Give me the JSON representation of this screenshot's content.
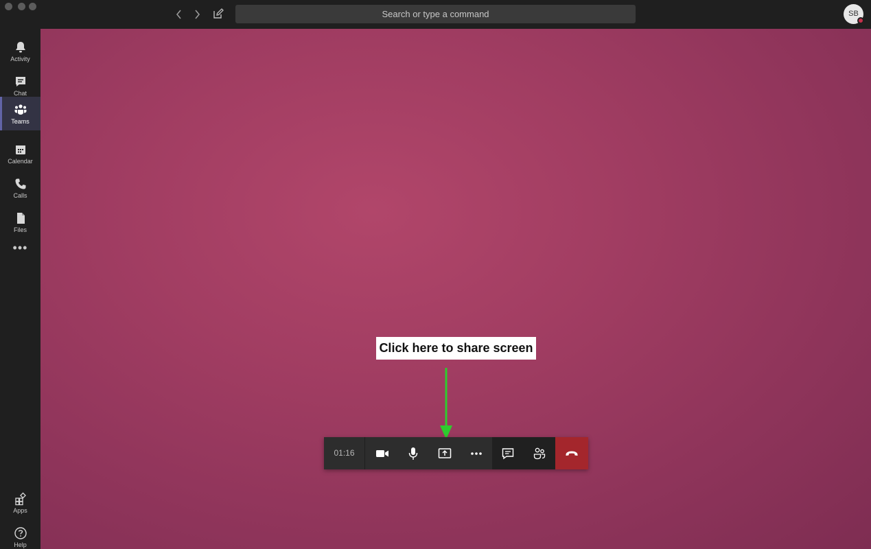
{
  "titlebar": {
    "search_placeholder": "Search or type a command",
    "avatar_initials": "SB",
    "back_icon": "chevron-left-icon",
    "forward_icon": "chevron-right-icon",
    "compose_icon": "new-chat-icon"
  },
  "rail": {
    "items": [
      {
        "label": "Activity",
        "icon": "bell-icon"
      },
      {
        "label": "Chat",
        "icon": "chat-icon"
      },
      {
        "label": "Teams",
        "icon": "teams-icon",
        "active": true
      },
      {
        "label": "Calendar",
        "icon": "calendar-icon"
      },
      {
        "label": "Calls",
        "icon": "phone-icon"
      },
      {
        "label": "Files",
        "icon": "file-icon"
      }
    ],
    "more_label": "•••",
    "bottom_items": [
      {
        "label": "Apps",
        "icon": "apps-icon"
      },
      {
        "label": "Help",
        "icon": "help-icon"
      }
    ]
  },
  "call": {
    "timer": "01:16",
    "controls": [
      "video-camera-icon",
      "microphone-icon",
      "share-screen-icon",
      "more-options-icon",
      "conversation-icon",
      "participants-icon",
      "hang-up-icon"
    ]
  },
  "annotation": {
    "callout_text": "Click here to share screen",
    "arrow_color": "#2ecc2e"
  },
  "colors": {
    "accent": "#6264a7",
    "hangup": "#a4262c",
    "stage": "#a13d62"
  }
}
